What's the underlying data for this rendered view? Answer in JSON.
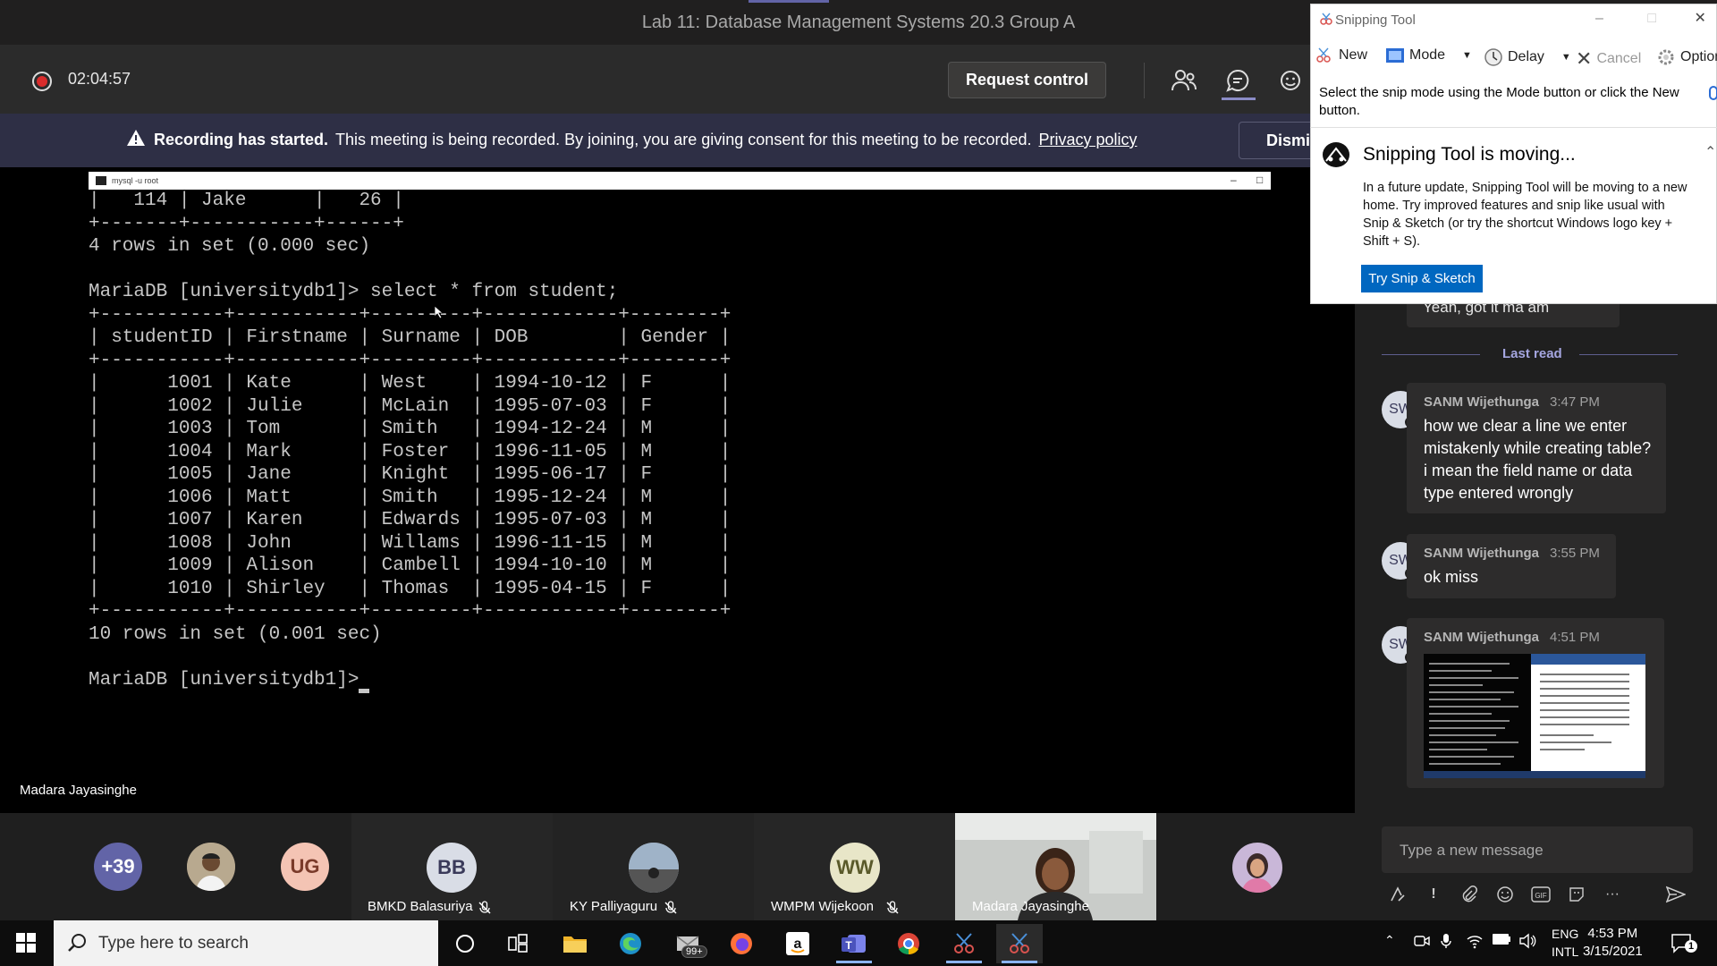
{
  "window": {
    "title": "Lab 11: Database Management Systems 20.3 Group A"
  },
  "meeting": {
    "timer": "02:04:57",
    "request_control_label": "Request control",
    "banner": {
      "bold": "Recording has started.",
      "text": "This meeting is being recorded. By joining, you are giving consent for this meeting to be recorded.",
      "link": "Privacy policy",
      "dismiss_label": "Dismiss"
    },
    "presenter_name": "Madara Jayasinghe"
  },
  "console": {
    "window_title": "mysql -u root",
    "lines": [
      "|   114 | Jake      |   26 |",
      "+-------+-----------+------+",
      "4 rows in set (0.000 sec)",
      "",
      "MariaDB [universitydb1]> select * from student;",
      "+-----------+-----------+---------+------------+--------+",
      "| studentID | Firstname | Surname | DOB        | Gender |",
      "+-----------+-----------+---------+------------+--------+",
      "|      1001 | Kate      | West    | 1994-10-12 | F      |",
      "|      1002 | Julie     | McLain  | 1995-07-03 | F      |",
      "|      1003 | Tom       | Smith   | 1994-12-24 | M      |",
      "|      1004 | Mark      | Foster  | 1996-11-05 | M      |",
      "|      1005 | Jane      | Knight  | 1995-06-17 | F      |",
      "|      1006 | Matt      | Smith   | 1995-12-24 | M      |",
      "|      1007 | Karen     | Edwards | 1995-07-03 | M      |",
      "|      1008 | John      | Willams | 1996-11-15 | M      |",
      "|      1009 | Alison    | Cambell | 1994-10-10 | M      |",
      "|      1010 | Shirley   | Thomas  | 1995-04-15 | F      |",
      "+-----------+-----------+---------+------------+--------+",
      "10 rows in set (0.001 sec)",
      "",
      "MariaDB [universitydb1]> "
    ]
  },
  "participants": [
    {
      "label": "+39",
      "color": "#6264a7"
    },
    {
      "label": "",
      "type": "photo"
    },
    {
      "label": "UG",
      "color": "#f4c4b4"
    },
    {
      "label": "BB",
      "name": "BMKD Balasuriya",
      "color": "#d9dde6"
    },
    {
      "label": "",
      "name": "KY Palliyaguru",
      "type": "photo"
    },
    {
      "label": "WW",
      "name": "WMPM Wijekoon",
      "color": "#e8e6c8"
    },
    {
      "label": "",
      "name": "Madara Jayasinghe",
      "type": "video"
    },
    {
      "label": "",
      "type": "photo"
    }
  ],
  "chat": {
    "top_message": "Yeah, got it ma am",
    "last_read_label": "Last read",
    "messages": [
      {
        "initials": "SW",
        "sender": "SANM Wijethunga",
        "time": "3:47 PM",
        "text": "how we clear a line we enter mistakenly while creating table? i mean the field name or data type entered wrongly"
      },
      {
        "initials": "SW",
        "sender": "SANM Wijethunga",
        "time": "3:55 PM",
        "text": "ok miss"
      },
      {
        "initials": "SW",
        "sender": "SANM Wijethunga",
        "time": "4:51 PM",
        "text": ""
      }
    ],
    "compose_placeholder": "Type a new message"
  },
  "snipping_tool": {
    "title": "Snipping Tool",
    "toolbar": {
      "new": "New",
      "mode": "Mode",
      "delay": "Delay",
      "cancel": "Cancel",
      "options": "Options"
    },
    "help": "Select the snip mode using the Mode button or click the New button.",
    "heading": "Snipping Tool is moving...",
    "body": "In a future update, Snipping Tool will be moving to a new home. Try improved features and snip like usual with Snip & Sketch (or try the shortcut Windows logo key + Shift + S).",
    "cta": "Try Snip & Sketch"
  },
  "taskbar": {
    "search_placeholder": "Type here to search",
    "mail_badge": "99+",
    "lang_top": "ENG",
    "lang_bottom": "INTL",
    "time": "4:53 PM",
    "date": "3/15/2021",
    "notification_count": "1"
  },
  "colors": {
    "teams_accent": "#6264a7",
    "recording_red": "#d92c2c",
    "snip_blue": "#0067c0"
  }
}
